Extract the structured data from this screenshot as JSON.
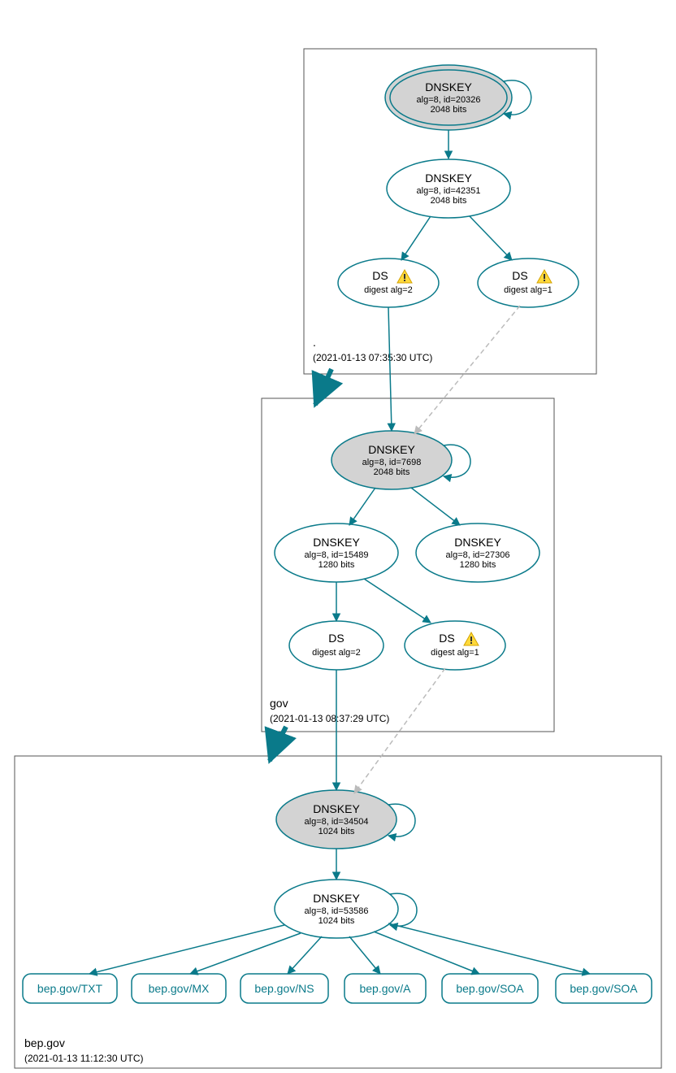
{
  "zones": {
    "root": {
      "label": ".",
      "timestamp": "(2021-01-13 07:35:30 UTC)"
    },
    "gov": {
      "label": "gov",
      "timestamp": "(2021-01-13 08:37:29 UTC)"
    },
    "bep": {
      "label": "bep.gov",
      "timestamp": "(2021-01-13 11:12:30 UTC)"
    }
  },
  "nodes": {
    "root_ksk": {
      "title": "DNSKEY",
      "line1": "alg=8, id=20326",
      "line2": "2048 bits"
    },
    "root_zsk": {
      "title": "DNSKEY",
      "line1": "alg=8, id=42351",
      "line2": "2048 bits"
    },
    "root_ds2": {
      "title": "DS",
      "line1": "digest alg=2"
    },
    "root_ds1": {
      "title": "DS",
      "line1": "digest alg=1"
    },
    "gov_ksk": {
      "title": "DNSKEY",
      "line1": "alg=8, id=7698",
      "line2": "2048 bits"
    },
    "gov_zsk1": {
      "title": "DNSKEY",
      "line1": "alg=8, id=15489",
      "line2": "1280 bits"
    },
    "gov_zsk2": {
      "title": "DNSKEY",
      "line1": "alg=8, id=27306",
      "line2": "1280 bits"
    },
    "gov_ds2": {
      "title": "DS",
      "line1": "digest alg=2"
    },
    "gov_ds1": {
      "title": "DS",
      "line1": "digest alg=1"
    },
    "bep_ksk": {
      "title": "DNSKEY",
      "line1": "alg=8, id=34504",
      "line2": "1024 bits"
    },
    "bep_zsk": {
      "title": "DNSKEY",
      "line1": "alg=8, id=53586",
      "line2": "1024 bits"
    }
  },
  "records": {
    "txt": "bep.gov/TXT",
    "mx": "bep.gov/MX",
    "ns": "bep.gov/NS",
    "a": "bep.gov/A",
    "soa1": "bep.gov/SOA",
    "soa2": "bep.gov/SOA"
  }
}
